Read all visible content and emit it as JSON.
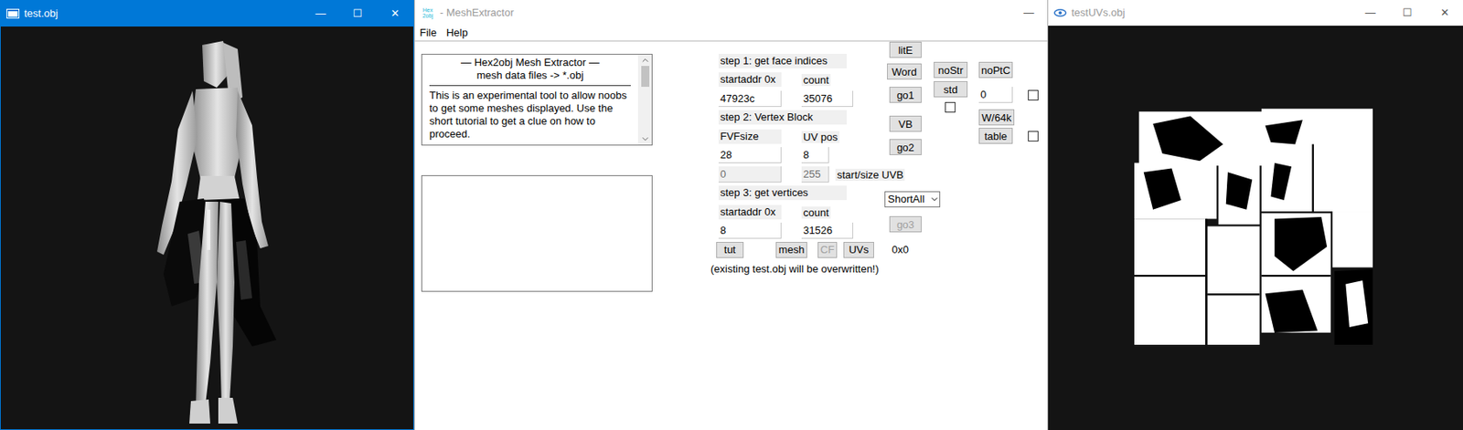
{
  "windows": {
    "viewer": {
      "title": "test.obj",
      "active": true,
      "controls": [
        "—",
        "☐",
        "✕"
      ]
    },
    "extractor": {
      "title": "- MeshExtractor",
      "logo": {
        "top": "Hex",
        "bottom": "2obj"
      },
      "active": false,
      "controls": [
        "—"
      ]
    },
    "uv_viewer": {
      "title": "testUVs.obj",
      "active": false,
      "controls": [
        "—",
        "☐",
        "✕"
      ]
    }
  },
  "menu": [
    "File",
    "Help"
  ],
  "info": {
    "heading": "—  Hex2obj Mesh Extractor  —",
    "subheading": "mesh data files -> *.obj",
    "body": "This is an experimental tool to allow noobs to get some meshes displayed. Use the short tutorial to get a clue on how to proceed."
  },
  "step1": {
    "title": "step 1: get face indices",
    "labels": [
      "startaddr 0x",
      "count"
    ],
    "fields": [
      "47923c",
      "35076"
    ]
  },
  "step2": {
    "title": "step 2: Vertex Block",
    "labels": [
      "FVFsize",
      "UV pos"
    ],
    "fields": [
      "28",
      "8"
    ],
    "uvb": {
      "fields": [
        "0",
        "255"
      ],
      "disabled": true,
      "label": "start/size UVB"
    }
  },
  "step3": {
    "title": "step 3: get vertices",
    "labels": [
      "startaddr 0x",
      "count"
    ],
    "fields": [
      "8",
      "31526"
    ]
  },
  "actions": [
    {
      "label": "tut",
      "disabled": false
    },
    {
      "label": "mesh",
      "disabled": false
    },
    {
      "label": "CF",
      "disabled": true
    },
    {
      "label": "UVs",
      "disabled": false
    }
  ],
  "result": "0x0",
  "warning": "(existing test.obj will be overwritten!)",
  "column_b": {
    "lite": {
      "label": "litE",
      "disabled": false
    },
    "word": {
      "label": "Word",
      "disabled": false
    },
    "go1": {
      "label": "go1",
      "disabled": false
    },
    "vb": {
      "label": "VB",
      "disabled": false
    },
    "go2": {
      "label": "go2",
      "disabled": false
    },
    "format": {
      "value": "ShortAll"
    },
    "go3": {
      "label": "go3",
      "disabled": true
    }
  },
  "column_c": {
    "nostr": {
      "label": "noStr",
      "disabled": false
    },
    "std": {
      "label": "std",
      "disabled": false
    },
    "std_checked": false
  },
  "column_d": {
    "noptc": {
      "label": "noPtC",
      "disabled": false
    },
    "field": "0",
    "field_checked": false,
    "w64k": {
      "label": "W/64k",
      "disabled": false
    },
    "table": {
      "label": "table",
      "disabled": false
    },
    "table_checked": false
  }
}
